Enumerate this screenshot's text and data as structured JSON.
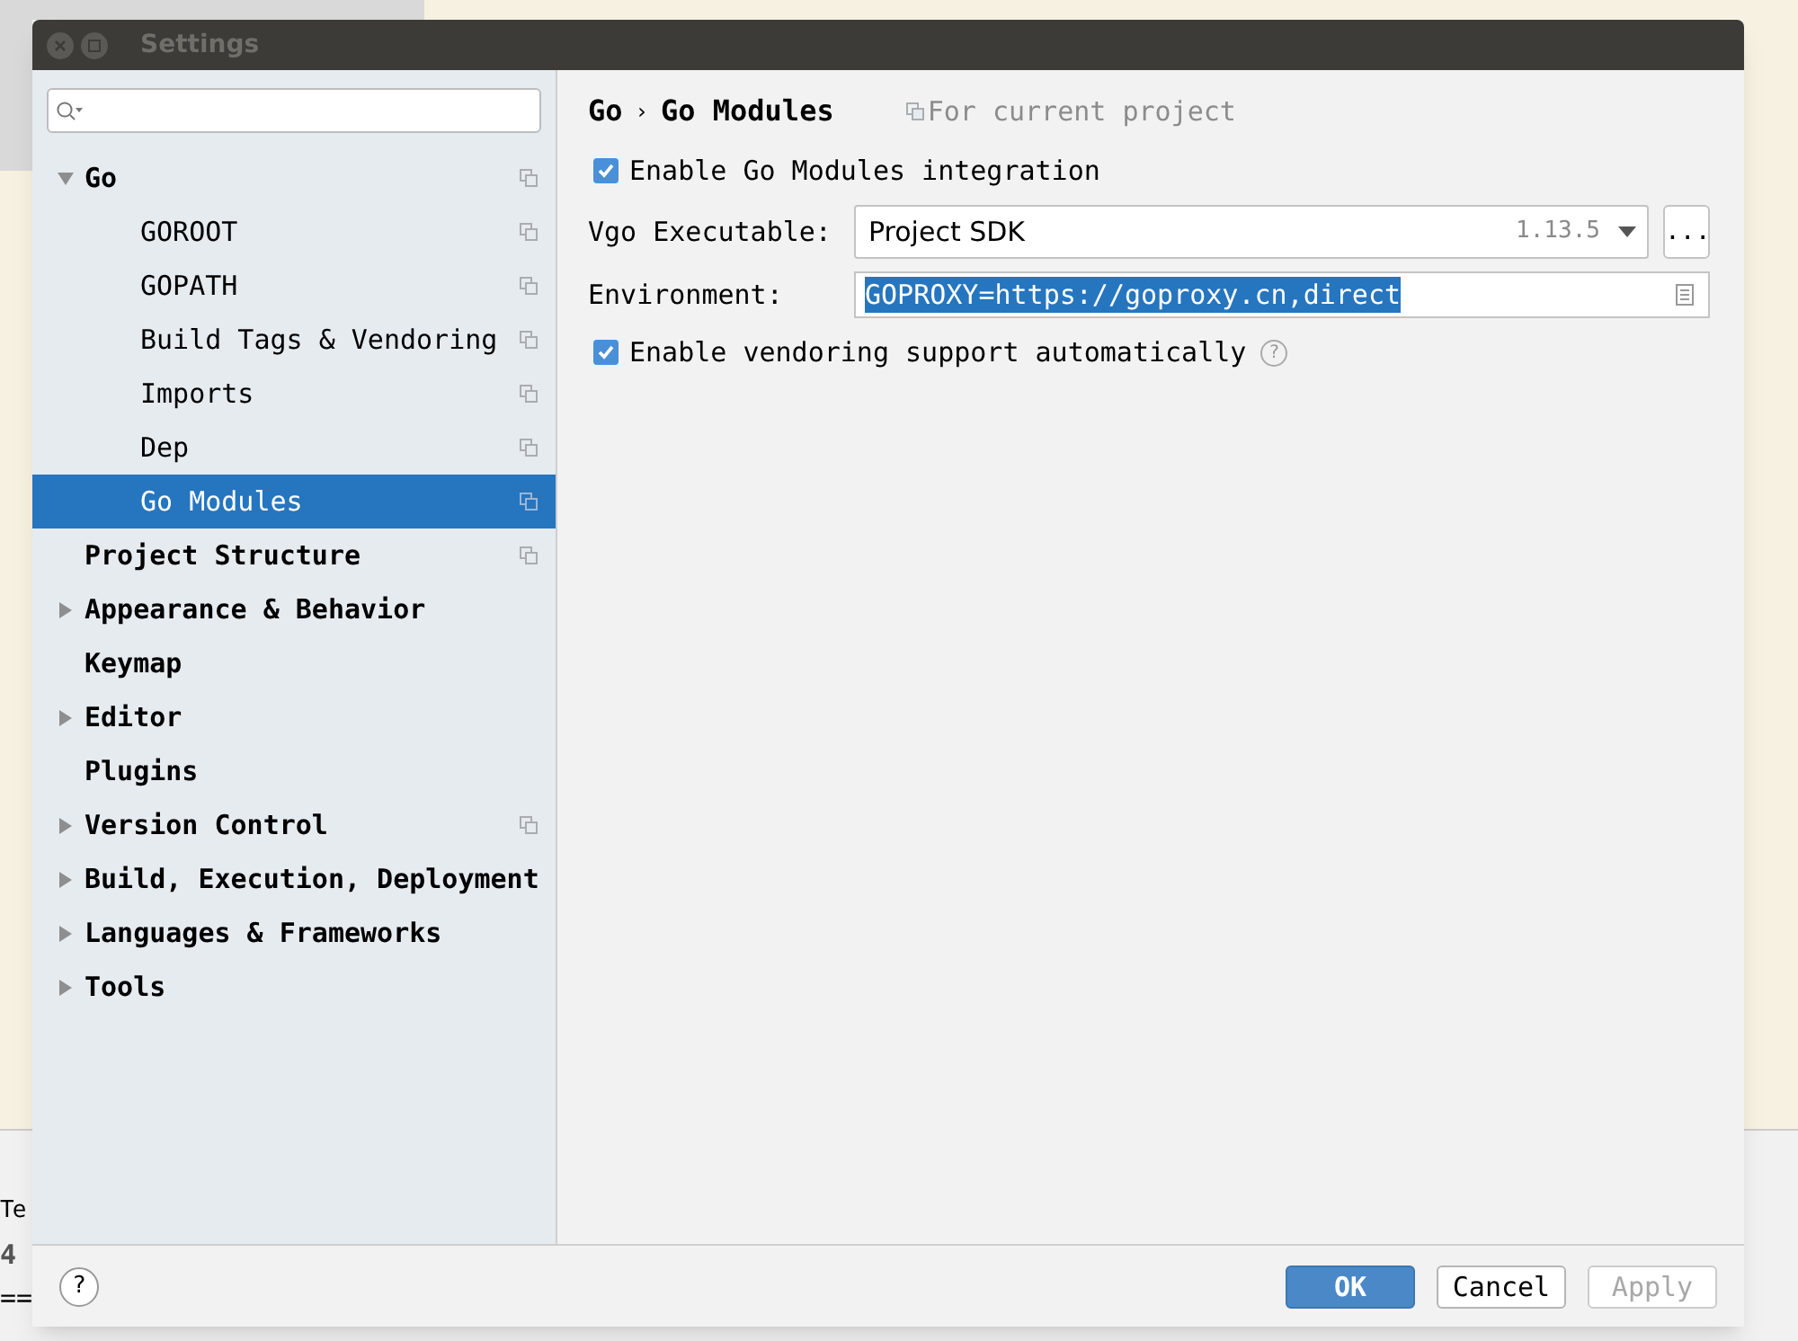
{
  "background": {
    "fragments": [
      "Te",
      "4",
      "=="
    ]
  },
  "window": {
    "title": "Settings"
  },
  "sidebar": {
    "items": [
      {
        "label": "Go",
        "expanded": true,
        "selected": false,
        "project_scope": true,
        "children": [
          {
            "label": "GOROOT",
            "selected": false,
            "project_scope": true
          },
          {
            "label": "GOPATH",
            "selected": false,
            "project_scope": true
          },
          {
            "label": "Build Tags & Vendoring",
            "selected": false,
            "project_scope": true
          },
          {
            "label": "Imports",
            "selected": false,
            "project_scope": true
          },
          {
            "label": "Dep",
            "selected": false,
            "project_scope": true
          },
          {
            "label": "Go Modules",
            "selected": true,
            "project_scope": true
          }
        ]
      },
      {
        "label": "Project Structure",
        "selected": false,
        "project_scope": true
      },
      {
        "label": "Appearance & Behavior",
        "expanded": false,
        "selected": false,
        "project_scope": false
      },
      {
        "label": "Keymap",
        "selected": false,
        "project_scope": false
      },
      {
        "label": "Editor",
        "expanded": false,
        "selected": false,
        "project_scope": false
      },
      {
        "label": "Plugins",
        "selected": false,
        "project_scope": false
      },
      {
        "label": "Version Control",
        "expanded": false,
        "selected": false,
        "project_scope": true
      },
      {
        "label": "Build, Execution, Deployment",
        "expanded": false,
        "selected": false,
        "project_scope": false
      },
      {
        "label": "Languages & Frameworks",
        "expanded": false,
        "selected": false,
        "project_scope": false
      },
      {
        "label": "Tools",
        "expanded": false,
        "selected": false,
        "project_scope": false
      }
    ]
  },
  "breadcrumb": [
    "Go",
    "Go Modules"
  ],
  "breadcrumb_separator": "›",
  "scope_note": "For current project",
  "form": [
    {
      "kind": "checkbox",
      "label": "Enable Go Modules integration",
      "checked": true
    },
    {
      "kind": "dropdown",
      "label": "Vgo Executable:",
      "value": "Project SDK",
      "version": "1.13.5",
      "browse": "..."
    },
    {
      "kind": "text",
      "label": "Environment:",
      "value": "GOPROXY=https://goproxy.cn,direct"
    },
    {
      "kind": "checkbox",
      "label": "Enable vendoring support automatically",
      "checked": true,
      "help": "?"
    }
  ],
  "footer": {
    "help": "?",
    "buttons": [
      {
        "label": "OK",
        "kind": "primary",
        "disabled": false
      },
      {
        "label": "Cancel",
        "kind": "normal",
        "disabled": false
      },
      {
        "label": "Apply",
        "kind": "normal",
        "disabled": true
      }
    ]
  }
}
